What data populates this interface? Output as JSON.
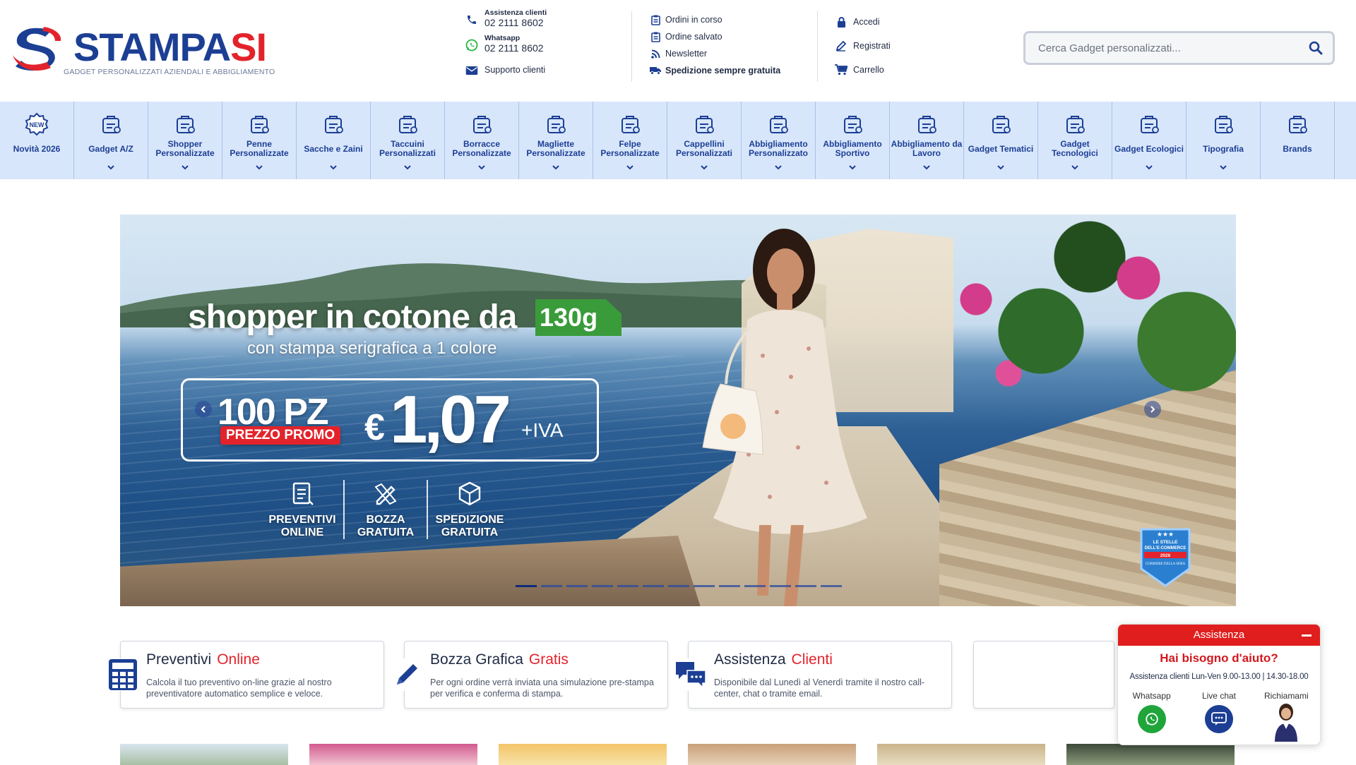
{
  "brand": {
    "name_part1": "STAMPA",
    "name_part2": "SI",
    "tagline": "GADGET PERSONALIZZATI AZIENDALI E ABBIGLIAMENTO",
    "colors": {
      "blue": "#1c3f94",
      "red": "#e3232b",
      "green": "#3a9b3a"
    }
  },
  "contact": {
    "assistance_label": "Assistenza clienti",
    "assistance_phone": "02 2111 8602",
    "whatsapp_label": "Whatsapp",
    "whatsapp_phone": "02 2111 8602",
    "support_link": "Supporto clienti"
  },
  "orders_menu": {
    "ongoing": "Ordini in corso",
    "saved": "Ordine salvato",
    "newsletter": "Newsletter",
    "shipping": "Spedizione sempre gratuita"
  },
  "account_menu": {
    "login": "Accedi",
    "register": "Registrati",
    "cart": "Carrello"
  },
  "search": {
    "placeholder": "Cerca Gadget personalizzati..."
  },
  "categories": [
    {
      "label": "Novità 2026",
      "icon": "new-badge-icon",
      "has_dropdown": false
    },
    {
      "label": "Gadget A/Z",
      "icon": "gadget-az-icon",
      "has_dropdown": true
    },
    {
      "label": "Shopper Personalizzate",
      "icon": "shopper-icon",
      "has_dropdown": true
    },
    {
      "label": "Penne Personalizzate",
      "icon": "pen-icon",
      "has_dropdown": true
    },
    {
      "label": "Sacche e Zaini",
      "icon": "backpack-icon",
      "has_dropdown": true
    },
    {
      "label": "Taccuini Personalizzati",
      "icon": "notebook-icon",
      "has_dropdown": true
    },
    {
      "label": "Borracce Personalizzate",
      "icon": "bottle-icon",
      "has_dropdown": true
    },
    {
      "label": "Magliette Personalizzate",
      "icon": "tshirt-icon",
      "has_dropdown": true
    },
    {
      "label": "Felpe Personalizzate",
      "icon": "hoodie-icon",
      "has_dropdown": true
    },
    {
      "label": "Cappellini Personalizzati",
      "icon": "cap-icon",
      "has_dropdown": true
    },
    {
      "label": "Abbigliamento Personalizzato",
      "icon": "clothing-icon",
      "has_dropdown": true
    },
    {
      "label": "Abbigliamento Sportivo",
      "icon": "sport-icon",
      "has_dropdown": true
    },
    {
      "label": "Abbigliamento da Lavoro",
      "icon": "worker-icon",
      "has_dropdown": true
    },
    {
      "label": "Gadget Tematici",
      "icon": "themed-icon",
      "has_dropdown": true
    },
    {
      "label": "Gadget Tecnologici",
      "icon": "tech-icon",
      "has_dropdown": true
    },
    {
      "label": "Gadget Ecologici",
      "icon": "eco-icon",
      "has_dropdown": true
    },
    {
      "label": "Tipografia",
      "icon": "print-icon",
      "has_dropdown": true
    },
    {
      "label": "Brands",
      "icon": "brands-icon",
      "has_dropdown": false
    }
  ],
  "hero": {
    "title": "shopper in cotone da",
    "badge": "130g",
    "subtitle": "con stampa serigrafica a 1 colore",
    "quantity": "100 PZ",
    "promo_label": "PREZZO PROMO",
    "currency": "€",
    "price": "1,07",
    "vat": "+IVA",
    "features": [
      {
        "label": "PREVENTIVI\nONLINE",
        "icon": "document-icon"
      },
      {
        "label": "BOZZA\nGRATUITA",
        "icon": "pencil-ruler-icon"
      },
      {
        "label": "SPEDIZIONE\nGRATUITA",
        "icon": "box-icon"
      }
    ],
    "slide_count": 13,
    "active_slide": 1,
    "seal_text": [
      "LE STELLE",
      "DELL'E-COMMERCE",
      "2026",
      "CORRIERE DELLA SERA"
    ]
  },
  "info_boxes": [
    {
      "title": "Preventivi",
      "accent": "Online",
      "text": "Calcola il tuo preventivo on-line grazie al nostro preventivatore automatico semplice e veloce.",
      "icon": "calculator-icon"
    },
    {
      "title": "Bozza Grafica",
      "accent": "Gratis",
      "text": "Per ogni ordine verrà inviata una simulazione pre-stampa per verifica e conferma di stampa.",
      "icon": "pencil-icon"
    },
    {
      "title": "Assistenza",
      "accent": "Clienti",
      "text": "Disponibile dal Lunedì al Venerdì tramite il nostro call-center, chat o tramite email.",
      "icon": "chat-bubbles-icon"
    }
  ],
  "assist_widget": {
    "header": "Assistenza",
    "question": "Hai bisogno d'aiuto?",
    "hours": "Assistenza clienti Lun-Ven 9.00-13.00 | 14.30-18.00",
    "options": [
      {
        "label": "Whatsapp",
        "icon": "whatsapp-icon"
      },
      {
        "label": "Live chat",
        "icon": "livechat-icon"
      },
      {
        "label": "Richiamami",
        "icon": "agent-avatar"
      }
    ]
  }
}
